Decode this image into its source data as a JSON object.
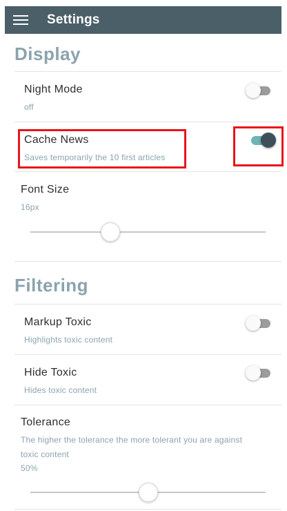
{
  "header": {
    "title": "Settings"
  },
  "sections": {
    "display": {
      "title": "Display"
    },
    "filtering": {
      "title": "Filtering"
    }
  },
  "settings": {
    "night_mode": {
      "label": "Night Mode",
      "value": "off",
      "enabled": false
    },
    "cache_news": {
      "label": "Cache News",
      "description": "Saves temporarily the 10 first articles",
      "enabled": true
    },
    "font_size": {
      "label": "Font Size",
      "value": "16px",
      "slider_fraction": 0.34
    },
    "markup_toxic": {
      "label": "Markup Toxic",
      "description": "Highlights toxic content",
      "enabled": false
    },
    "hide_toxic": {
      "label": "Hide Toxic",
      "description": "Hides toxic content",
      "enabled": false
    },
    "tolerance": {
      "label": "Tolerance",
      "description_line1": "The higher the tolerance the more tolerant you are against",
      "description_line2": "toxic content",
      "value": "50%",
      "slider_fraction": 0.5
    }
  },
  "colors": {
    "header_bg": "#4b5f68",
    "section_title": "#8aa3ad",
    "toggle_on_track": "#6fb3b3",
    "toggle_on_knob": "#3d4f58",
    "highlight": "#e8141b"
  }
}
